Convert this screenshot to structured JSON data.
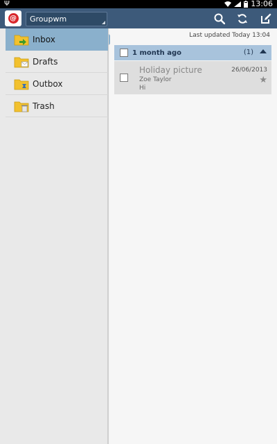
{
  "status_bar": {
    "time": "13:06"
  },
  "toolbar": {
    "account": "Groupwm"
  },
  "folders": [
    {
      "label": "Inbox",
      "active": true
    },
    {
      "label": "Drafts",
      "active": false
    },
    {
      "label": "Outbox",
      "active": false
    },
    {
      "label": "Trash",
      "active": false
    }
  ],
  "main": {
    "last_updated": "Last updated  Today 13:04",
    "group": {
      "label": "1 month ago",
      "count": "(1)"
    },
    "emails": [
      {
        "subject": "Holiday picture",
        "sender": "Zoe Taylor",
        "snippet": "Hi",
        "date": "26/06/2013"
      }
    ]
  },
  "colors": {
    "action_bar": "#3d5a7a",
    "active_folder": "#8ab0cc",
    "group_header": "#a8c3dc"
  }
}
